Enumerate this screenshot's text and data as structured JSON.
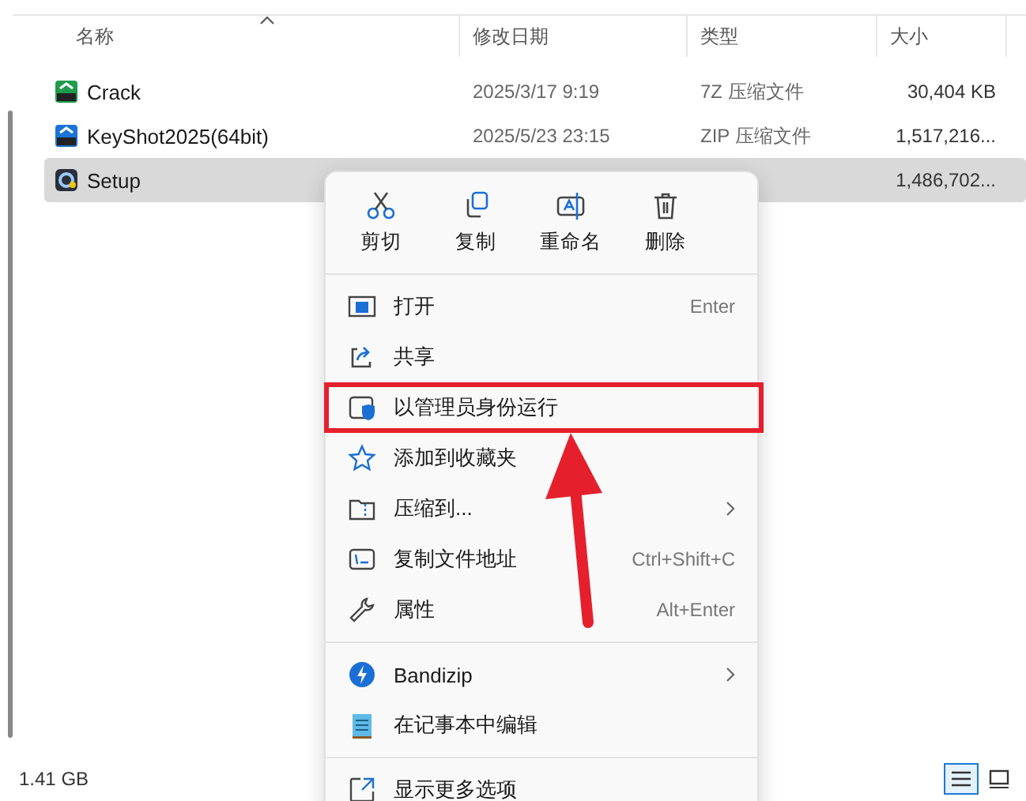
{
  "columns": [
    "名称",
    "修改日期",
    "类型",
    "大小"
  ],
  "files": [
    {
      "name": "Crack",
      "date": "2025/3/17 9:19",
      "type": "7Z 压缩文件",
      "size": "30,404 KB",
      "selected": false
    },
    {
      "name": "KeyShot2025(64bit)",
      "date": "2025/5/23 23:15",
      "type": "ZIP 压缩文件",
      "size": "1,517,216...",
      "selected": false
    },
    {
      "name": "Setup",
      "size": "1,486,702...",
      "selected": true
    }
  ],
  "context_menu": {
    "actions": [
      "剪切",
      "复制",
      "重命名",
      "删除"
    ],
    "groups": [
      [
        {
          "label": "打开",
          "shortcut": "Enter",
          "submenu": false,
          "annotated": false
        },
        {
          "label": "共享",
          "submenu": false,
          "annotated": false
        },
        {
          "label": "以管理员身份运行",
          "submenu": false,
          "annotated": true
        },
        {
          "label": "添加到收藏夹",
          "submenu": false,
          "annotated": false
        },
        {
          "label": "压缩到...",
          "submenu": true,
          "annotated": false
        },
        {
          "label": "复制文件地址",
          "shortcut": "Ctrl+Shift+C",
          "submenu": false,
          "annotated": false
        },
        {
          "label": "属性",
          "shortcut": "Alt+Enter",
          "submenu": false,
          "annotated": false
        }
      ],
      [
        {
          "label": "Bandizip",
          "submenu": true,
          "annotated": false
        },
        {
          "label": "在记事本中编辑",
          "submenu": false,
          "annotated": false
        }
      ],
      [
        {
          "label": "显示更多选项",
          "submenu": false,
          "annotated": false
        }
      ]
    ]
  },
  "status_bar": {
    "selection_size": "1.41 GB",
    "view_buttons": [
      {
        "selected": true
      },
      {
        "selected": false
      }
    ]
  }
}
